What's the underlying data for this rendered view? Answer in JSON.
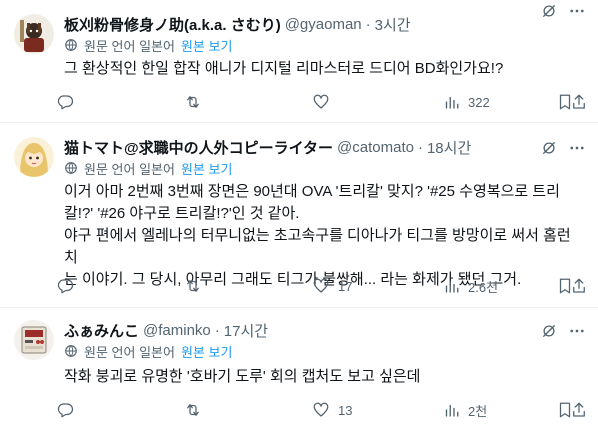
{
  "translate": {
    "note": "원문 언어 일본어",
    "link": "원본 보기"
  },
  "tweets": [
    {
      "name": "板刈粉骨修身ノ助(a.k.a. さむり)",
      "handle": "@gyaoman",
      "dot": "·",
      "time": "3시간",
      "text": "그 환상적인 한일 합작 애니가 디지털 리마스터로 드디어 BD화인가요!?",
      "views": "322"
    },
    {
      "name": "猫トマト@求職中の人外コピーライター",
      "handle": "@catomato",
      "dot": "·",
      "time": "18시간",
      "text": "이거 아마 2번째 3번째 장면은 90년대 OVA '트리칼' 맞지? '#25 수영복으로 트리\n칼!?' '#26 야구로 트리칼!?'인 것 같아.\n야구 편에서 엘레나의 터무니없는 초고속구를 디아나가 티그를 방망이로 써서 홈런 치\n는 이야기. 그 당시, 아무리 그래도 티그가 불쌍해... 라는 화제가 됐던 그거.",
      "likes": "17",
      "views": "2.6천"
    },
    {
      "name": "ふぁみんこ",
      "handle": "@faminko",
      "dot": "·",
      "time": "17시간",
      "text": "작화 붕괴로 유명한 '호바기 도루' 회의 캡처도 보고 싶은데",
      "likes": "13",
      "views": "2천"
    }
  ]
}
